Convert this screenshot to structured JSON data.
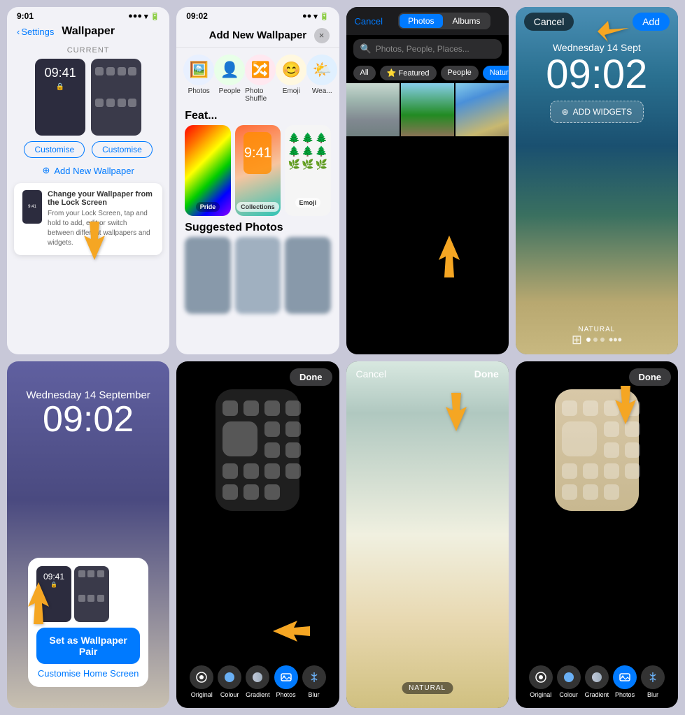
{
  "page": {
    "background": "#c8c8d8"
  },
  "cell1": {
    "status_time": "9:01",
    "nav_back": "Settings",
    "title": "Wallpaper",
    "current_label": "CURRENT",
    "lock_time": "09:41",
    "btn_customise1": "Customise",
    "btn_customise2": "Customise",
    "add_new_label": "Add New Wallpaper",
    "tooltip_title": "Change your Wallpaper from the Lock Screen",
    "tooltip_body": "From your Lock Screen, tap and hold to add, edit or switch between different wallpapers and widgets.",
    "mini_time": "9:41"
  },
  "cell2": {
    "status_time": "09:02",
    "modal_title": "Add New Wallpaper",
    "close": "×",
    "types": [
      {
        "icon": "🖼️",
        "label": "Photos"
      },
      {
        "icon": "👤",
        "label": "People"
      },
      {
        "icon": "🔀",
        "label": "Photo Shuffle"
      },
      {
        "icon": "😊",
        "label": "Emoji"
      },
      {
        "icon": "⌚",
        "label": "Wea..."
      }
    ],
    "featured_label": "Feat...",
    "featured_items": [
      {
        "label": "Pride"
      },
      {
        "label": "Collections"
      },
      {
        "label": "Emoji"
      }
    ],
    "suggested_label": "Suggested Photos"
  },
  "cell3": {
    "cancel": "Cancel",
    "tab_photos": "Photos",
    "tab_albums": "Albums",
    "search_placeholder": "Photos, People, Places...",
    "filters": [
      "All",
      "Featured",
      "People",
      "Nature"
    ],
    "active_filter": "Nature"
  },
  "cell4": {
    "cancel": "Cancel",
    "add": "Add",
    "date": "Wednesday 14 Sept",
    "time": "09:02",
    "add_widgets": "ADD WIDGETS",
    "natural_label": "NATURAL",
    "dot_count": 3
  },
  "cell5": {
    "date": "Wednesday 14 September",
    "time": "09:02",
    "lock_time": "09:41",
    "set_btn": "Set as Wallpaper Pair",
    "customise_link": "Customise Home Screen"
  },
  "cell6": {
    "done": "Done",
    "toolbar_items": [
      {
        "icon": "⊙",
        "label": "Original"
      },
      {
        "icon": "●",
        "label": "Colour"
      },
      {
        "icon": "◑",
        "label": "Gradient"
      },
      {
        "icon": "🖼",
        "label": "Photos"
      },
      {
        "icon": "💧",
        "label": "Blur"
      }
    ],
    "active_tool": "Photos"
  },
  "cell7": {
    "cancel": "Cancel",
    "done": "Done",
    "natural_label": "NATURAL"
  },
  "cell8": {
    "done": "Done",
    "toolbar_items": [
      {
        "icon": "⊙",
        "label": "Original"
      },
      {
        "icon": "●",
        "label": "Colour"
      },
      {
        "icon": "◑",
        "label": "Gradient"
      },
      {
        "icon": "🖼",
        "label": "Photos"
      },
      {
        "icon": "💧",
        "label": "Blur"
      }
    ],
    "active_tool": "Photos"
  }
}
